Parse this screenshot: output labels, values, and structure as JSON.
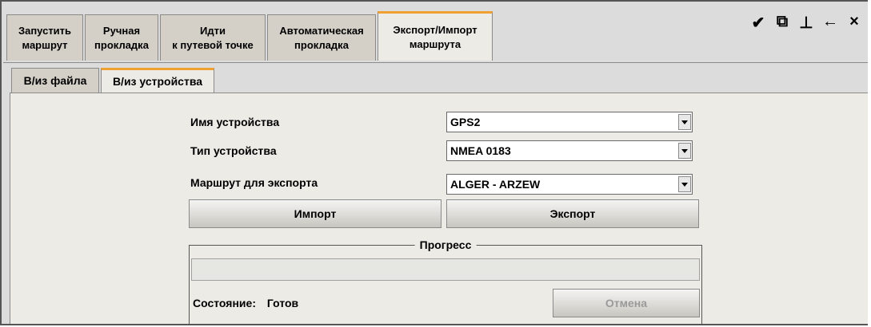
{
  "tabs": [
    {
      "label": "Запустить\nмаршрут",
      "active": false
    },
    {
      "label": "Ручная\nпрокладка",
      "active": false
    },
    {
      "label": "Идти\nк путевой точке",
      "active": false
    },
    {
      "label": "Автоматическая\nпрокладка",
      "active": false
    },
    {
      "label": "Экспорт/Импорт\nмаршрута",
      "active": true
    }
  ],
  "subtabs": [
    {
      "label": "В/из файла",
      "active": false
    },
    {
      "label": "В/из устройства",
      "active": true
    }
  ],
  "form": {
    "device_name_label": "Имя устройства",
    "device_name_value": "GPS2",
    "device_type_label": "Тип устройства",
    "device_type_value": "NMEA 0183",
    "route_label": "Маршрут для экспорта",
    "route_value": "ALGER - ARZEW"
  },
  "buttons": {
    "import": "Импорт",
    "export": "Экспорт",
    "cancel": "Отмена"
  },
  "progress": {
    "title": "Прогресс",
    "status_label": "Состояние:",
    "status_value": "Готов",
    "fraction": 0
  },
  "toolbar": {
    "icons": [
      "broom-icon",
      "window-restore-icon",
      "pin-icon",
      "back-arrow-icon",
      "close-icon"
    ],
    "glyphs": [
      "✔",
      "⧉",
      "⊥",
      "←",
      "×"
    ]
  },
  "colors": {
    "accent": "#f0a030",
    "panel": "#ecebe6"
  }
}
